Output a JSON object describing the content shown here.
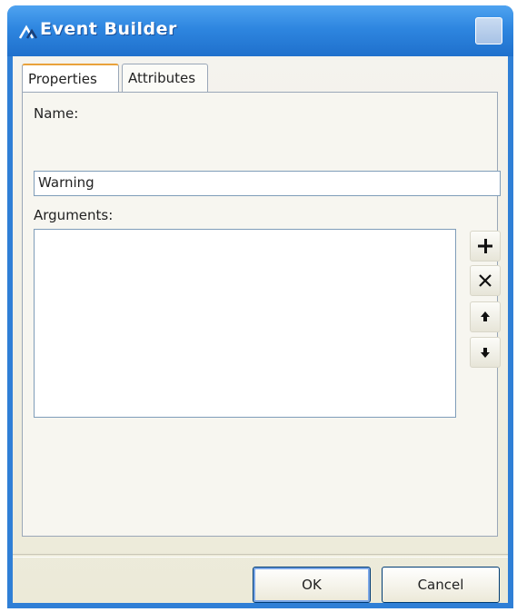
{
  "window": {
    "title": "Event Builder"
  },
  "tabs": [
    {
      "label": "Properties",
      "active": true
    },
    {
      "label": "Attributes",
      "active": false
    }
  ],
  "form": {
    "name_label": "Name:",
    "name_value": "Warning",
    "arguments_label": "Arguments:",
    "arguments_items": []
  },
  "side_buttons": [
    {
      "name": "add",
      "icon": "plus-icon"
    },
    {
      "name": "remove",
      "icon": "close-x-icon"
    },
    {
      "name": "move-up",
      "icon": "arrow-up-icon"
    },
    {
      "name": "move-down",
      "icon": "arrow-down-icon"
    }
  ],
  "buttons": {
    "ok_label": "OK",
    "cancel_label": "Cancel"
  },
  "colors": {
    "titlebar": "#2e86e0",
    "window_bg": "#ece9d8",
    "active_tab_accent": "#e9a23b"
  }
}
